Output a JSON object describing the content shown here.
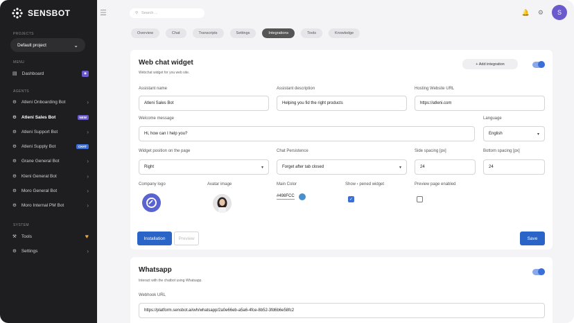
{
  "brand": {
    "name": "SENSBOT"
  },
  "sidebar": {
    "projects_label": "PROJECTS",
    "project_selected": "Default project",
    "menu_label": "MENU",
    "menu_items": [
      {
        "label": "Dashboard"
      }
    ],
    "agents_label": "AGENTS",
    "agents": [
      {
        "label": "Atleni Onboarding Bot"
      },
      {
        "label": "Atleni Sales Bot",
        "badge": "NEW"
      },
      {
        "label": "Atleni Support Bot"
      },
      {
        "label": "Atleni Supply Bot",
        "badge": "CHAT"
      },
      {
        "label": "Grane General Bot"
      },
      {
        "label": "Kleni General Bot"
      },
      {
        "label": "Moro General Bot"
      },
      {
        "label": "Moro Internal PM  Bot"
      }
    ],
    "system_label": "SYSTEM",
    "system_items": [
      {
        "label": "Tools"
      },
      {
        "label": "Settings"
      }
    ]
  },
  "topbar": {
    "search_placeholder": "Search ...",
    "avatar_initial": "S"
  },
  "tabs": [
    {
      "label": "Overview"
    },
    {
      "label": "Chat"
    },
    {
      "label": "Transcripts"
    },
    {
      "label": "Settings"
    },
    {
      "label": "Integrations",
      "active": true
    },
    {
      "label": "Tools"
    },
    {
      "label": "Knowledge"
    }
  ],
  "webchat": {
    "title": "Web chat widget",
    "subtitle": "Webchat widget for you web site.",
    "add_integration": "+ Add integration",
    "enabled": true,
    "assistant_name_label": "Assistant name",
    "assistant_name": "Atleni Sales Bot",
    "assistant_desc_label": "Assistant description",
    "assistant_desc": "Helping you fid the right products",
    "hosting_label": "Hosting Website URL",
    "hosting_url": "https://atleni.com",
    "welcome_label": "Welcome message",
    "welcome": "Hi, how can I help you?",
    "language_label": "Language",
    "language": "English",
    "position_label": "Widget position on the page",
    "position": "Right",
    "persistence_label": "Chat Persistence",
    "persistence": "Forget after tab closed",
    "side_spacing_label": "Side spacing [px]",
    "side_spacing": "24",
    "bottom_spacing_label": "Bottom spacing [px]",
    "bottom_spacing": "24",
    "logo_label": "Company logo",
    "avatar_label": "Avatar image",
    "color_label": "Main Color",
    "main_color": "#498FCC",
    "show_opened_label": "Show ‹ pened widget",
    "show_opened": true,
    "preview_enabled_label": "Preview page enabled",
    "preview_enabled": false,
    "installation_button": "Installation",
    "preview_button": "Preview",
    "save_button": "Save",
    "logo_color": "#5a64d0"
  },
  "whatsapp": {
    "title": "Whatsapp",
    "subtitle": "Interact with the chatbot using Whatsapp.",
    "enabled": true,
    "webhook_label": "Webhook URL",
    "webhook_url": "https://platform.sensbot.ai/wh/whatsapp/2a0e66eb-a5a6-4fce-8b52-3fd6b6e58fc2"
  }
}
